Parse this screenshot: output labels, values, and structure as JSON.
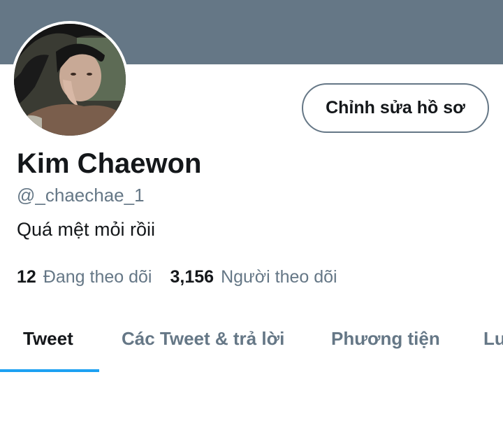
{
  "profile": {
    "avatar_icon": "profile-photo",
    "edit_button_label": "Chỉnh sửa hồ sơ",
    "display_name": "Kim Chaewon",
    "handle": "@_chaechae_1",
    "bio": "Quá mệt mỏi rồii",
    "following_count": "12",
    "following_label": "Đang theo dõi",
    "followers_count": "3,156",
    "followers_label": "Người theo dõi"
  },
  "tabs": [
    {
      "label": "Tweet",
      "active": true
    },
    {
      "label": "Các Tweet & trả lời",
      "active": false
    },
    {
      "label": "Phương tiện",
      "active": false
    },
    {
      "label": "Lu",
      "active": false
    }
  ],
  "colors": {
    "banner": "#657786",
    "accent": "#1da1f2",
    "text_primary": "#14171a",
    "text_secondary": "#657786"
  }
}
